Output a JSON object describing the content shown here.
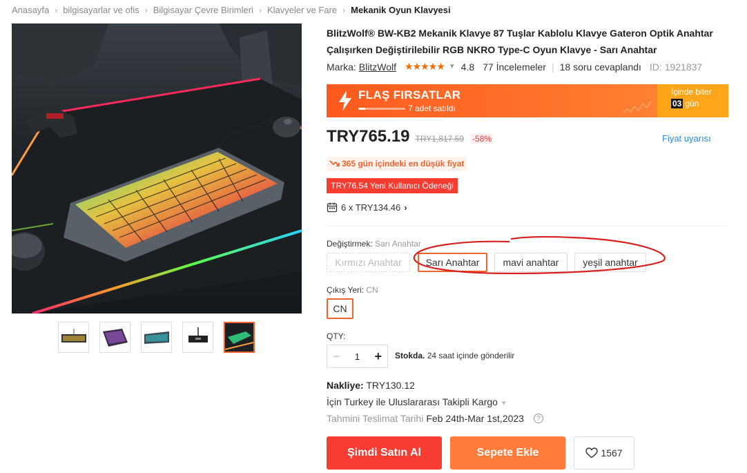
{
  "breadcrumb": [
    "Anasayfa",
    "bilgisayarlar ve ofis",
    "Bilgisayar Çevre Birimleri",
    "Klavyeler ve Fare",
    "Mekanik Oyun Klavyesi"
  ],
  "product": {
    "title": "BlitzWolf® BW-KB2 Mekanik Klavye 87 Tuşlar Kablolu Klavye Gateron Optik Anahtar Çalışırken Değiştirilebilir RGB NKRO Type-C Oyun Klavye - Sarı Anahtar",
    "brand_label": "Marka:",
    "brand": "BlitzWolf",
    "stars_icon": "★★★★★",
    "rating": "4.8",
    "reviews": "77 İncelemeler",
    "questions": "18 soru cevaplandı",
    "id": "ID: 1921837"
  },
  "flash": {
    "title": "FLAŞ FIRSATLAR",
    "sold": "7 adet satıldı",
    "sold_fraction": 0.15,
    "ends_label": "İçinde biter",
    "days": "03",
    "days_unit": "gün",
    "accent_color": "#ff5a1f",
    "ends_color": "#ffa51a"
  },
  "price": {
    "current": "TRY765.19",
    "old": "TRY1,817.59",
    "discount": "-58%",
    "alert": "Fiyat uyarısı",
    "lowest": "365 gün içindeki en düşük fiyat",
    "new_user": "TRY76.54 Yeni Kullanıcı Ödeneği",
    "installment": "6 x TRY134.46"
  },
  "variant": {
    "label": "Değiştirmek:",
    "value": "Sarı Anahtar",
    "options": [
      "Kırmızı Anahtar",
      "Sarı Anahtar",
      "mavi anahtar",
      "yeşil anahtar"
    ]
  },
  "origin": {
    "label": "Çıkış Yeri:",
    "value": "CN",
    "option": "CN"
  },
  "quantity": {
    "label": "QTY:",
    "value": "1",
    "stock": "Stokda.",
    "stock_note": "24 saat içinde gönderilir"
  },
  "shipping": {
    "label": "Nakliye:",
    "price": "TRY130.12",
    "method": "İçin Turkey ile Uluslararası Takipli Kargo",
    "eta_label": "Tahmini Teslimat Tarihi",
    "eta": "Feb 24th-Mar 1st,2023"
  },
  "actions": {
    "buy": "Şimdi Satın Al",
    "cart": "Sepete Ekle",
    "wish_count": "1567"
  }
}
